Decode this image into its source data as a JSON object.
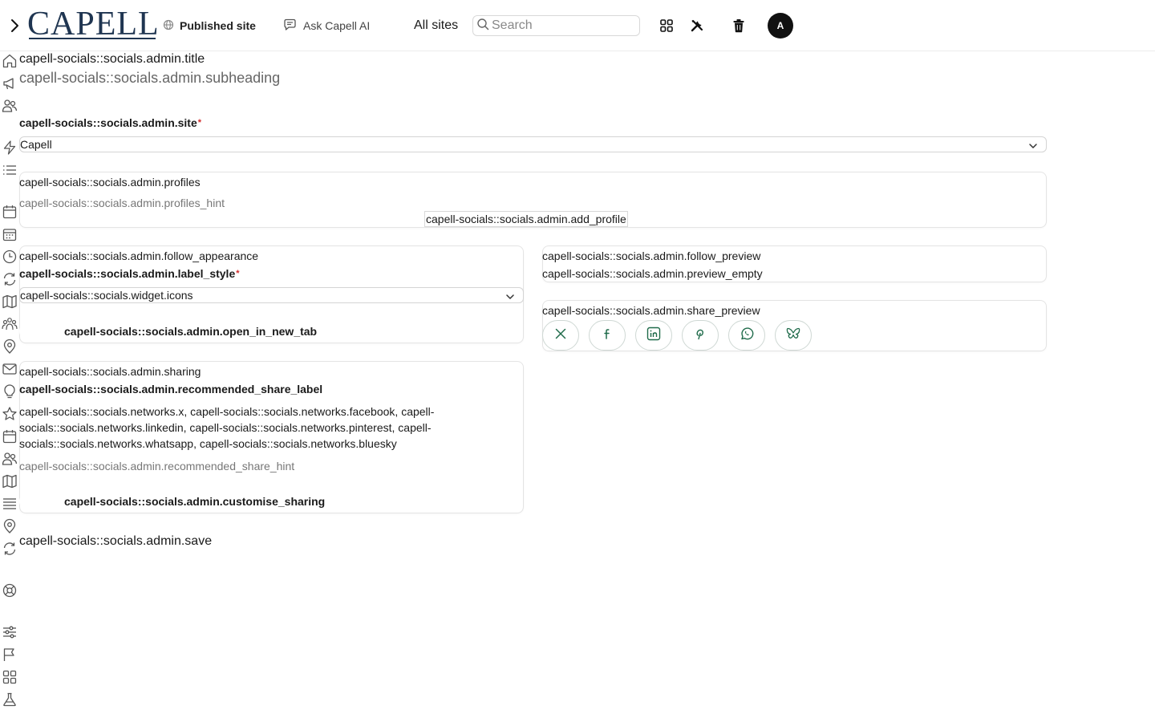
{
  "header": {
    "logo_text": "CAPELL",
    "published_label": "Published site",
    "ask_ai_label": "Ask Capell AI",
    "all_sites_label": "All sites",
    "search_placeholder": "Search",
    "avatar_initial": "A"
  },
  "sidebar": {
    "icons": [
      "home-icon",
      "megaphone-icon",
      "users-icon",
      "bolt-icon",
      "list-icon",
      "calendar-icon",
      "calendar-grid-icon",
      "clock-icon",
      "refresh-icon",
      "map-icon",
      "group-icon",
      "location-pin-icon",
      "mail-icon",
      "lightbulb-icon",
      "star-icon",
      "calendar-alt-icon",
      "users-alt-icon",
      "map-alt-icon",
      "lines-icon",
      "location-pin-alt-icon",
      "sync-icon",
      "globe-icon",
      "sliders-icon",
      "flag-icon",
      "apps-icon",
      "flask-icon"
    ]
  },
  "page": {
    "title": "capell-socials::socials.admin.title",
    "subheading": "capell-socials::socials.admin.subheading",
    "site_label": "capell-socials::socials.admin.site",
    "site_value": "Capell",
    "profiles": {
      "title": "capell-socials::socials.admin.profiles",
      "hint": "capell-socials::socials.admin.profiles_hint",
      "add_button": "capell-socials::socials.admin.add_profile"
    },
    "follow": {
      "title": "capell-socials::socials.admin.follow_appearance",
      "label_style": "capell-socials::socials.admin.label_style",
      "label_style_value": "capell-socials::socials.widget.icons",
      "open_new_tab": "capell-socials::socials.admin.open_in_new_tab"
    },
    "follow_preview": {
      "title": "capell-socials::socials.admin.follow_preview",
      "empty": "capell-socials::socials.admin.preview_empty"
    },
    "share_preview": {
      "title": "capell-socials::socials.admin.share_preview",
      "buttons": [
        "x-icon",
        "facebook-icon",
        "linkedin-icon",
        "pinterest-icon",
        "whatsapp-icon",
        "bluesky-icon"
      ]
    },
    "sharing": {
      "title": "capell-socials::socials.admin.sharing",
      "recommended_label": "capell-socials::socials.admin.recommended_share_label",
      "networks_line1": "capell-socials::socials.networks.x, capell-socials::socials.networks.facebook, capell-",
      "networks_line2": "socials::socials.networks.linkedin, capell-socials::socials.networks.pinterest, capell-",
      "networks_line3": "socials::socials.networks.whatsapp, capell-socials::socials.networks.bluesky",
      "hint": "capell-socials::socials.admin.recommended_share_hint",
      "customise": "capell-socials::socials.admin.customise_sharing"
    },
    "save_label": "capell-socials::socials.admin.save"
  },
  "colors": {
    "brand": "#1f3551",
    "required": "#d12a2a",
    "share_icon": "#1f6b4a"
  }
}
